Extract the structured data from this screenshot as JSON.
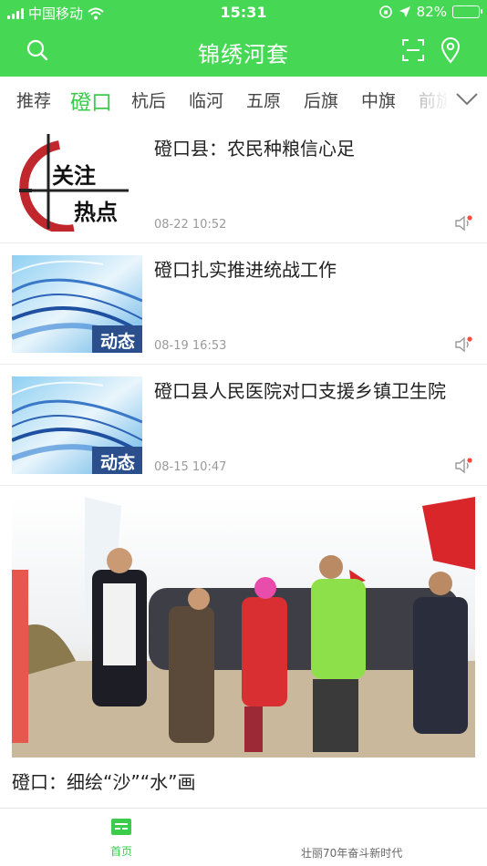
{
  "status_bar": {
    "carrier": "中国移动",
    "time": "15:31",
    "battery_percent": "82%",
    "battery_level": 0.82
  },
  "navbar": {
    "title": "锦绣河套",
    "icons": [
      "search-icon",
      "scan-icon",
      "location-icon"
    ]
  },
  "tabs": {
    "items": [
      "推荐",
      "磴口",
      "杭后",
      "临河",
      "五原",
      "后旗",
      "中旗",
      "前旗"
    ],
    "active": "磴口",
    "more_icon": "chevron-down-icon"
  },
  "articles": [
    {
      "title": "磴口县：农民种粮信心足",
      "time": "08-22 10:52",
      "thumb_text": [
        "关注",
        "热点"
      ]
    },
    {
      "title": "磴口扎实推进统战工作",
      "time": "08-19 16:53",
      "thumb_text": [
        "动态"
      ]
    },
    {
      "title": "磴口县人民医院对口支援乡镇卫生院",
      "time": "08-15 10:47",
      "thumb_text": [
        "动态"
      ]
    }
  ],
  "feature": {
    "title": "磴口：细绘“沙”“水”画"
  },
  "tabbar": {
    "home_label": "首页",
    "slogan": "壮丽70年奋斗新时代"
  },
  "colors": {
    "brand_green": "#46d855",
    "active_tab": "#3ccc4c",
    "badge_red": "#ff4a3d"
  }
}
